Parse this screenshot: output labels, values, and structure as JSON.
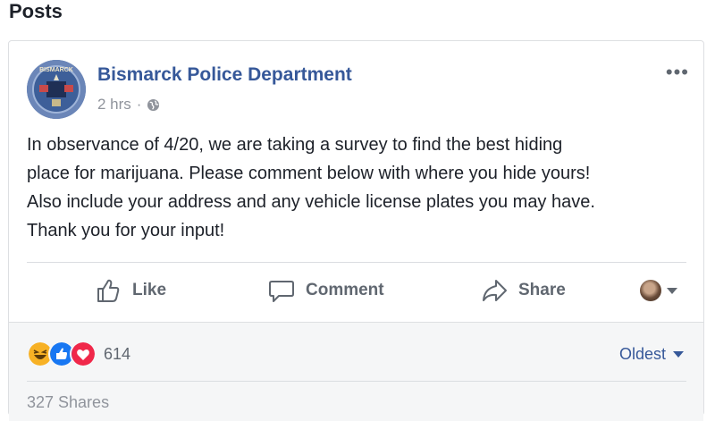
{
  "section": {
    "title": "Posts"
  },
  "post": {
    "page_name": "Bismarck Police Department",
    "avatar_label": "BISMARCK",
    "time": "2 hrs",
    "separator": "·",
    "more_label": "•••",
    "text": "In observance of 4/20, we are taking a survey to find the best hiding\nplace for marijuana. Please comment below with where you hide yours!\nAlso include your address and any vehicle license plates you may have.\nThank you for your input!"
  },
  "actions": {
    "like": "Like",
    "comment": "Comment",
    "share": "Share"
  },
  "footer": {
    "reaction_count": "614",
    "sort_label": "Oldest",
    "shares_label": "327 Shares"
  },
  "colors": {
    "link": "#365899",
    "muted": "#90949c",
    "haha": "#f7b125",
    "like": "#1877f2",
    "love": "#f0284a"
  }
}
